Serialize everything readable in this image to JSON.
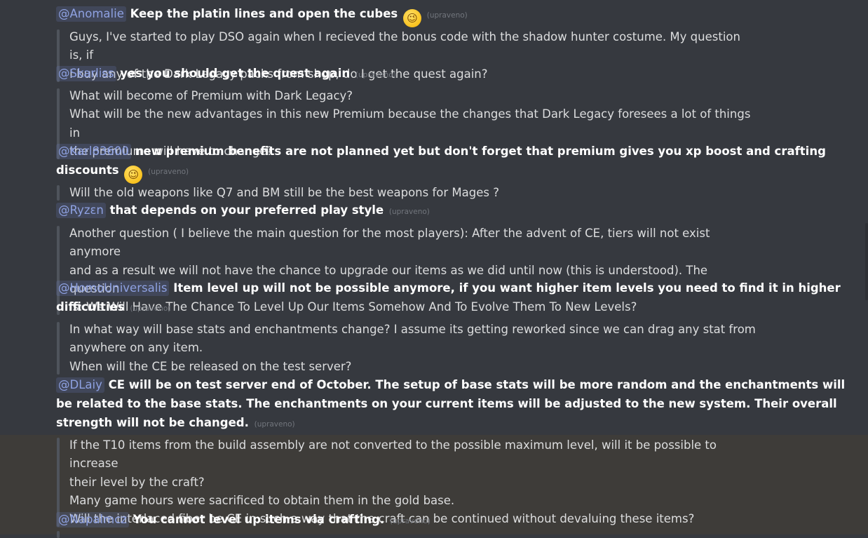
{
  "messages": [
    {
      "reply": {
        "mention": "@Anomalie",
        "text": "Keep the platin lines and open the cubes",
        "emoji": "wink-emoji",
        "edited": "(upraveno)"
      }
    },
    {
      "quote": [
        "Guys, I've started to play DSO again when I recieved the bonus code with the shadow hunter costume. My question is, if",
        "I buy any of the Dark Legacy packs from shop, do I get the quest again?"
      ],
      "reply": {
        "mention": "@Skarliss",
        "text": "yes you should get the quest again",
        "edited": "(upraveno)"
      }
    },
    {
      "quote": [
        "What will become of Premium with Dark Legacy?",
        "What will be the new advantages in this new Premium because the changes that Dark Legacy foresees a lot of things in",
        "the premiums will have to change?"
      ],
      "reply": {
        "mention": "@Karl83600",
        "text": "new premium benefits are not planned yet but don't forget that premium gives you xp boost and crafting discounts",
        "emoji": "wink-emoji",
        "edited": "(upraveno)"
      }
    },
    {
      "quote": [
        "Will the old weapons like Q7 and BM still be the best weapons for Mages ?"
      ],
      "reply": {
        "mention": "@Ryzɛn",
        "text": "that depends on your preferred play style",
        "edited": "(upraveno)"
      }
    },
    {
      "quote": [
        "Another question ( I believe the main question for the most players): After the advent of CE,  tiers will not exist anymore",
        "and as a result we will not have the chance to upgrade our items as we did until now (this is understood). The question",
        "is: We Will Have The Chance To Level Up Our Items Somehow And To Evolve Them To New Levels?"
      ],
      "reply": {
        "mention": "@HomoUniversalis",
        "text": "Item level up will not be possible anymore, if you want higher item levels you need to find it in higher difficulties",
        "edited": "(upraveno)"
      }
    },
    {
      "quote": [
        "In what way will base stats and enchantments change? I assume its getting reworked since we can drag any stat from",
        "anywhere on any item.",
        "When will the CE be released on the test server?"
      ],
      "reply": {
        "mention": "@DLaiy",
        "text": "CE will be on test server end of October. The setup of base stats will be more random and the enchantments will be related to the base stats. The enchantments on your current items will be adjusted to the new system. Their overall strength will not be changed.",
        "edited": "(upraveno)"
      }
    },
    {
      "quote": [
        "If the T10 items from the build assembly are not converted to the possible maximum level, will it be possible to increase",
        "their level by the craft?",
        "Many game hours were sacrificed to obtain them in the gold base.",
        "Will the interlaced fiber be CE in such a way that the craft can be continued without devaluing these items?"
      ],
      "reply": {
        "mention": "@Napalmcz",
        "text": "You cannot level up items via crafting.",
        "edited": "(upraveno)"
      }
    }
  ]
}
